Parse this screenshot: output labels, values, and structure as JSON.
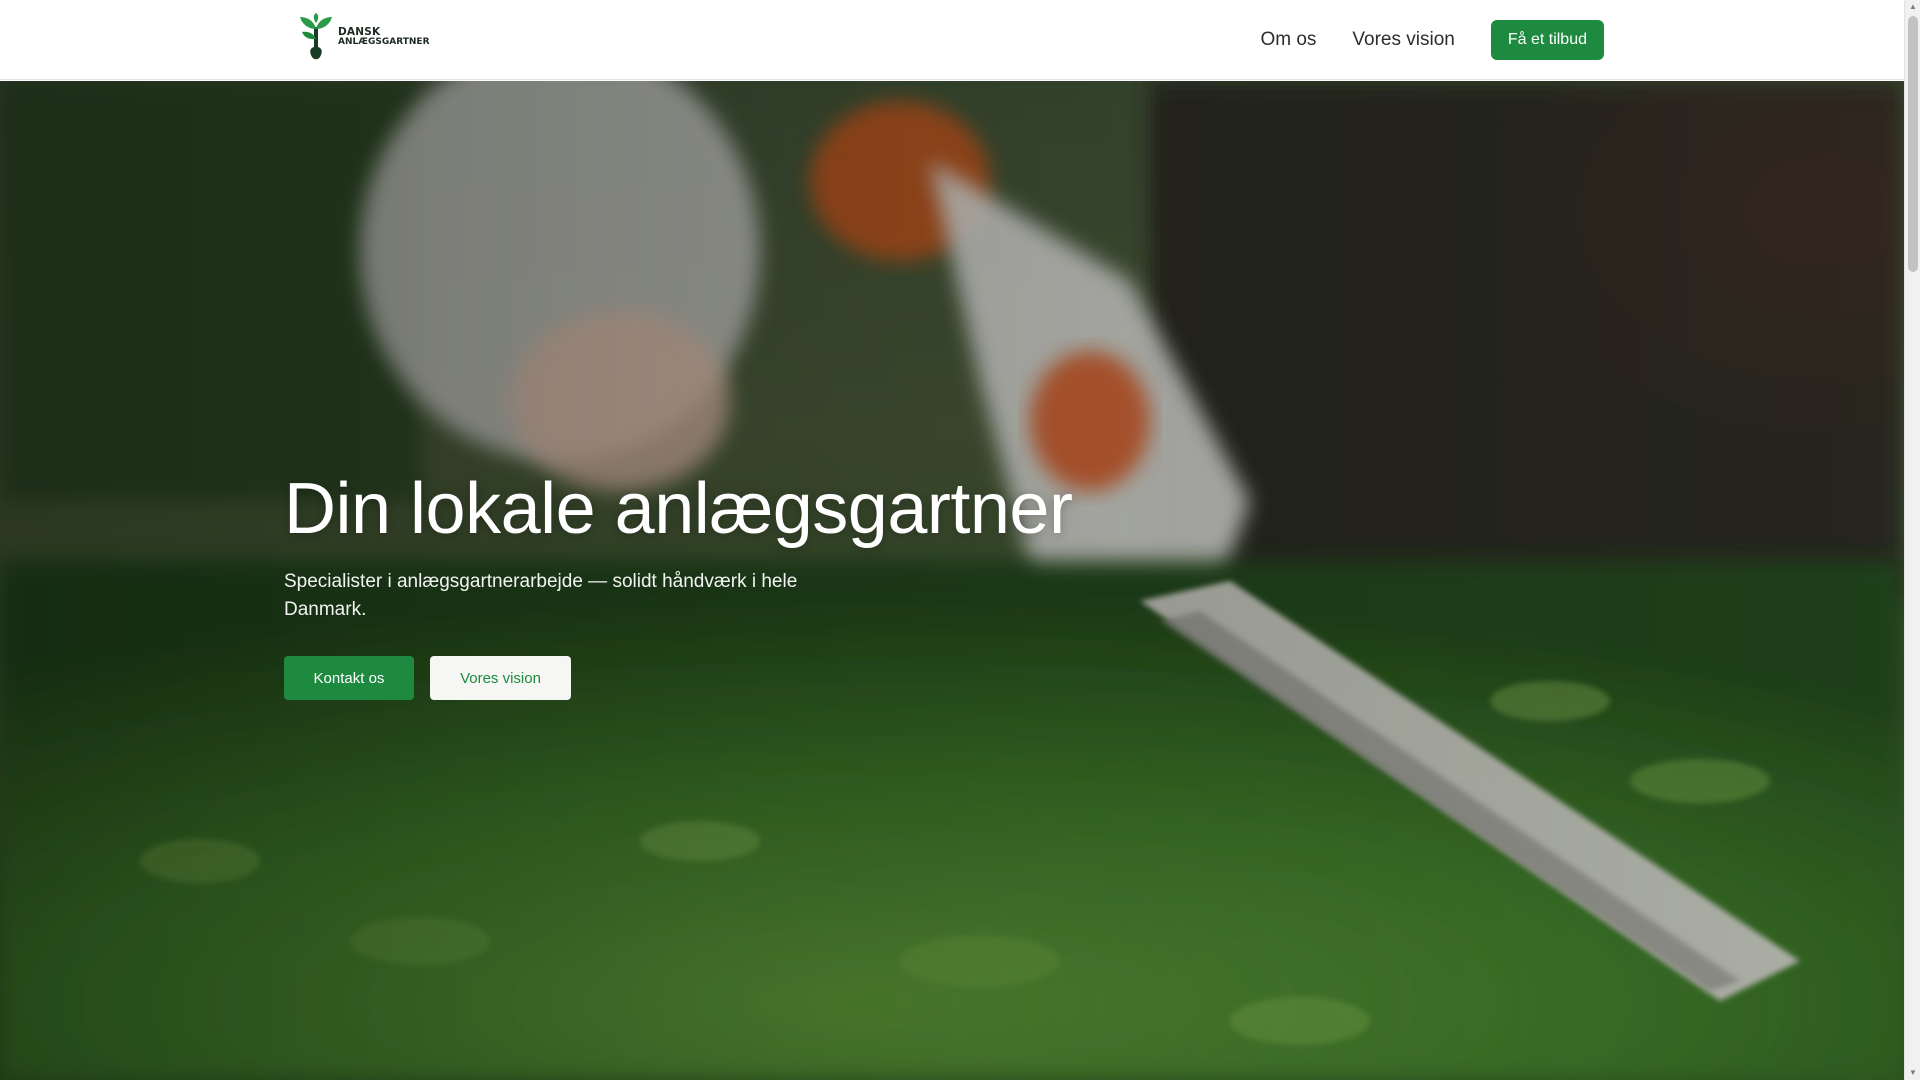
{
  "header": {
    "logo_line1": "DANSK",
    "logo_line2": "ANLÆGSGARTNER",
    "nav": [
      {
        "label": "Om os"
      },
      {
        "label": "Vores vision"
      }
    ],
    "cta_label": "Få et tilbud"
  },
  "hero": {
    "title": "Din lokale anlægsgartner",
    "subtitle": "Specialister i anlægsgartnerarbejde — solidt håndværk i hele Danmark.",
    "primary_button": "Kontakt os",
    "secondary_button": "Vores vision"
  },
  "colors": {
    "brand_green": "#1e8a3f",
    "header_bg": "#ffffff",
    "hero_text": "#ffffff"
  },
  "icons": {
    "logo": "plant-shovel-icon",
    "scroll_up": "triangle-up-icon",
    "scroll_down": "triangle-down-icon"
  }
}
